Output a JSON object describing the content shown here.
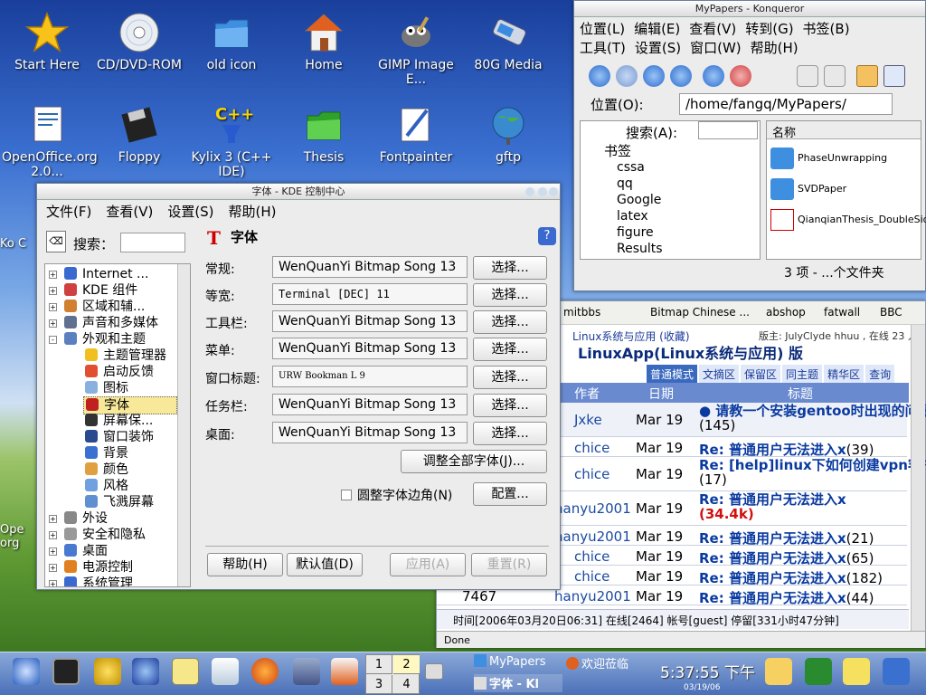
{
  "desktop_icons": [
    {
      "label": "Start Here",
      "icon": "star-icon"
    },
    {
      "label": "CD/DVD-ROM",
      "icon": "cd-icon"
    },
    {
      "label": "old icon",
      "icon": "folder-icon"
    },
    {
      "label": "Home",
      "icon": "home-icon"
    },
    {
      "label": "GIMP Image E...",
      "icon": "gimp-icon"
    },
    {
      "label": "80G Media",
      "icon": "usb-icon"
    },
    {
      "label": "OpenOffice.org 2.0...",
      "icon": "openoffice-icon"
    },
    {
      "label": "Floppy",
      "icon": "floppy-icon"
    },
    {
      "label": "Kylix 3 (C++ IDE)",
      "icon": "kylix-icon"
    },
    {
      "label": "Thesis",
      "icon": "folder-icon"
    },
    {
      "label": "Fontpainter",
      "icon": "paint-icon"
    },
    {
      "label": "gftp",
      "icon": "globe-icon"
    }
  ],
  "left_edge_labels": {
    "top": "Ko C",
    "bottom": "Ope org"
  },
  "kcontrol": {
    "title": "字体 - KDE 控制中心",
    "menu": [
      "文件(F)",
      "查看(V)",
      "设置(S)",
      "帮助(H)"
    ],
    "search_label": "搜索：",
    "panel_title": "字体",
    "tree": [
      {
        "label": "Internet ...",
        "exp": "+"
      },
      {
        "label": "KDE 组件",
        "exp": "+"
      },
      {
        "label": "区域和辅...",
        "exp": "+"
      },
      {
        "label": "声音和多媒体",
        "exp": "+"
      },
      {
        "label": "外观和主题",
        "exp": "-"
      },
      {
        "label": "主题管理器",
        "exp": ""
      },
      {
        "label": "启动反馈",
        "exp": ""
      },
      {
        "label": "图标",
        "exp": ""
      },
      {
        "label": "字体",
        "exp": "",
        "selected": true
      },
      {
        "label": "屏幕保...",
        "exp": ""
      },
      {
        "label": "窗口装饰",
        "exp": ""
      },
      {
        "label": "背景",
        "exp": ""
      },
      {
        "label": "颜色",
        "exp": ""
      },
      {
        "label": "风格",
        "exp": ""
      },
      {
        "label": "飞溅屏幕",
        "exp": ""
      },
      {
        "label": "外设",
        "exp": "+"
      },
      {
        "label": "安全和隐私",
        "exp": "+"
      },
      {
        "label": "桌面",
        "exp": "+"
      },
      {
        "label": "电源控制",
        "exp": "+"
      },
      {
        "label": "系统管理",
        "exp": "+"
      }
    ],
    "fonts": [
      {
        "label": "常规:",
        "value": "WenQuanYi Bitmap Song 13",
        "button": "选择..."
      },
      {
        "label": "等宽:",
        "value": "Terminal [DEC] 11",
        "button": "选择..."
      },
      {
        "label": "工具栏:",
        "value": "WenQuanYi Bitmap Song 13",
        "button": "选择..."
      },
      {
        "label": "菜单:",
        "value": "WenQuanYi Bitmap Song 13",
        "button": "选择..."
      },
      {
        "label": "窗口标题:",
        "value": "URW Bookman L 9",
        "button": "选择..."
      },
      {
        "label": "任务栏:",
        "value": "WenQuanYi Bitmap Song 13",
        "button": "选择..."
      },
      {
        "label": "桌面:",
        "value": "WenQuanYi Bitmap Song 13",
        "button": "选择..."
      }
    ],
    "adjust_all": "调整全部字体(J)...",
    "antialias_label": "圆整字体边角(N)",
    "configure": "配置...",
    "bottom_buttons": {
      "help": "帮助(H)",
      "defaults": "默认值(D)",
      "apply": "应用(A)",
      "reset": "重置(R)"
    }
  },
  "konqueror": {
    "title": "MyPapers - Konqueror",
    "menu1": [
      "位置(L)",
      "编辑(E)",
      "查看(V)",
      "转到(G)",
      "书签(B)"
    ],
    "menu2": [
      "工具(T)",
      "设置(S)",
      "窗口(W)",
      "帮助(H)"
    ],
    "location_label": "位置(O):",
    "location_value": "/home/fangq/MyPapers/",
    "sidebar_search": "搜索(A):",
    "bookmarks_header": "书签",
    "bookmarks": [
      "cssa",
      "qq",
      "Google",
      "latex",
      "figure",
      "Results"
    ],
    "column_header": "名称",
    "files": [
      "PhaseUnwrapping",
      "SVDPaper",
      "QianqianThesis_DoubleSided"
    ],
    "status": "3 项 - ...个文件夹"
  },
  "browser": {
    "bookmarks_bar": [
      "mitbbs",
      "Bitmap Chinese ...",
      "abshop",
      "fatwall",
      "BBC"
    ],
    "breadcrumb": "Linux系统与应用 (收藏)",
    "moderators": "版主: JulyClyde hhuu , 在线 23 人",
    "board_title": "LinuxApp(Linux系统与应用) 版",
    "tabs": [
      "普通模式",
      "文摘区",
      "保留区",
      "同主题",
      "精华区",
      "查询"
    ],
    "columns": [
      "作者",
      "日期",
      "标题"
    ],
    "rows": [
      {
        "num": "",
        "author": "Jxke",
        "date": "Mar 19",
        "title": "● 请教一个安装gentoo时出现的问题",
        "count": "(145)"
      },
      {
        "num": "",
        "author": "chice",
        "date": "Mar 19",
        "title": "Re: 普通用户无法进入x",
        "count": "(39)"
      },
      {
        "num": "",
        "author": "chice",
        "date": "Mar 19",
        "title": "Re: [help]linux下如何创建vpn客户端?",
        "count": "(17)"
      },
      {
        "num": "",
        "author": "hanyu2001",
        "date": "Mar 19",
        "title": "Re: 普通用户无法进入x",
        "count": "(34.4k)"
      },
      {
        "num": "",
        "author": "hanyu2001",
        "date": "Mar 19",
        "title": "Re: 普通用户无法进入x",
        "count": "(21)"
      },
      {
        "num": "",
        "author": "chice",
        "date": "Mar 19",
        "title": "Re: 普通用户无法进入x",
        "count": "(65)"
      },
      {
        "num": "",
        "author": "chice",
        "date": "Mar 19",
        "title": "Re: 普通用户无法进入x",
        "count": "(182)"
      },
      {
        "num": "7467",
        "author": "hanyu2001",
        "date": "Mar 19",
        "title": "Re: 普通用户无法进入x",
        "count": "(44)"
      }
    ],
    "footer": "时间[2006年03月20日06:31] 在线[2464] 帐号[guest] 停留[331小时47分钟]",
    "status": "Done"
  },
  "taskbar": {
    "desktops": [
      "1",
      "2",
      "3",
      "4"
    ],
    "tasks": [
      "MyPapers",
      "欢迎莅临",
      "字体 - Kl"
    ],
    "clock": "5:37:55 下午",
    "date": "03/19/06"
  }
}
